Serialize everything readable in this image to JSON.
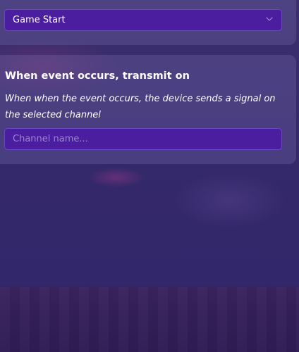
{
  "trigger_select": {
    "value": "Game Start"
  },
  "transmit_section": {
    "title": "When event occurs, transmit on",
    "description": "When when the event occurs, the device sends a signal on the selected channel",
    "channel_input": {
      "value": "",
      "placeholder": "Channel name..."
    }
  },
  "colors": {
    "field_bg": "#4b1ea0",
    "field_border": "#6b45c8",
    "panel_bg": "#4c4580",
    "page_bg": "#33285f"
  },
  "icons": {
    "dropdown": "chevron-down-icon"
  }
}
